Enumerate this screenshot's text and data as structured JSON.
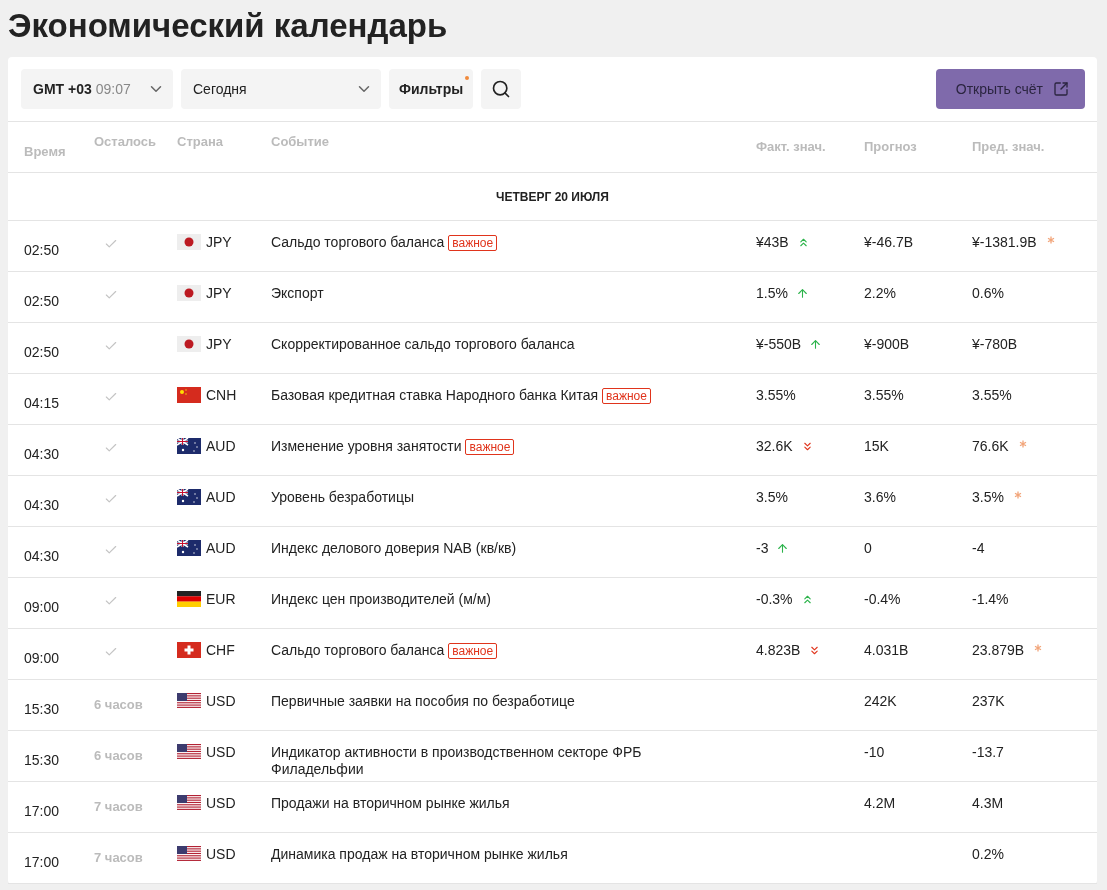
{
  "title": "Экономический календарь",
  "toolbar": {
    "timezone": {
      "label": "GMT +03",
      "time": "09:07"
    },
    "period": "Сегодня",
    "filters": {
      "label": "Фильтры",
      "active": true
    },
    "open_account": "Открыть счёт"
  },
  "table": {
    "columns": [
      "Время",
      "Осталось",
      "Страна",
      "Событие",
      "Факт. знач.",
      "Прогноз",
      "Пред. знач."
    ],
    "day": "ЧЕТВЕРГ 20 ИЮЛЯ",
    "rows": [
      {
        "time": "02:50",
        "done": true,
        "flag": {
          "kind": "jp"
        },
        "currency": "JPY",
        "event": "Сальдо торгового баланса",
        "badge": "важное",
        "actual": "¥43B",
        "trend": {
          "kind": "strongup"
        },
        "forecast": "¥-46.7B",
        "previous": "¥-1381.9B",
        "revised": true
      },
      {
        "time": "02:50",
        "done": true,
        "flag": {
          "kind": "jp"
        },
        "currency": "JPY",
        "event": "Экспорт",
        "actual": "1.5%",
        "trend": {
          "kind": "up"
        },
        "forecast": "2.2%",
        "previous": "0.6%",
        "revised": false
      },
      {
        "time": "02:50",
        "done": true,
        "flag": {
          "kind": "jp"
        },
        "currency": "JPY",
        "event": "Скорректированное сальдо торгового баланса",
        "actual": "¥-550B",
        "trend": {
          "kind": "up"
        },
        "forecast": "¥-900B",
        "previous": "¥-780B",
        "revised": false
      },
      {
        "time": "04:15",
        "done": true,
        "flag": {
          "kind": "cn"
        },
        "currency": "CNH",
        "event": "Базовая кредитная ставка Народного банка Китая",
        "badge": "важное",
        "actual": "3.55%",
        "forecast": "3.55%",
        "previous": "3.55%",
        "revised": false
      },
      {
        "time": "04:30",
        "done": true,
        "flag": {
          "kind": "au"
        },
        "currency": "AUD",
        "event": "Изменение уровня занятости",
        "badge": "важное",
        "actual": "32.6K",
        "trend": {
          "kind": "strongdown"
        },
        "forecast": "15K",
        "previous": "76.6K",
        "revised": true
      },
      {
        "time": "04:30",
        "done": true,
        "flag": {
          "kind": "au"
        },
        "currency": "AUD",
        "event": "Уровень безработицы",
        "actual": "3.5%",
        "forecast": "3.6%",
        "previous": "3.5%",
        "revised": true
      },
      {
        "time": "04:30",
        "done": true,
        "flag": {
          "kind": "au"
        },
        "currency": "AUD",
        "event": "Индекс делового доверия NAB (кв/кв)",
        "actual": "-3",
        "trend": {
          "kind": "up"
        },
        "forecast": "0",
        "previous": "-4",
        "revised": false
      },
      {
        "time": "09:00",
        "done": true,
        "flag": {
          "kind": "de"
        },
        "currency": "EUR",
        "event": "Индекс цен производителей (м/м)",
        "actual": "-0.3%",
        "trend": {
          "kind": "strongup"
        },
        "forecast": "-0.4%",
        "previous": "-1.4%",
        "revised": false
      },
      {
        "time": "09:00",
        "done": true,
        "flag": {
          "kind": "ch"
        },
        "currency": "CHF",
        "event": "Сальдо торгового баланса",
        "badge": "важное",
        "actual": "4.823B",
        "trend": {
          "kind": "strongdown"
        },
        "forecast": "4.031B",
        "previous": "23.879B",
        "revised": true
      },
      {
        "time": "15:30",
        "done": false,
        "remaining": "6 часов",
        "flag": {
          "kind": "us"
        },
        "currency": "USD",
        "event": "Первичные заявки на пособия по безработице",
        "forecast": "242K",
        "previous": "237K",
        "revised": false
      },
      {
        "time": "15:30",
        "done": false,
        "remaining": "6 часов",
        "flag": {
          "kind": "us"
        },
        "currency": "USD",
        "event": "Индикатор активности в производственном секторе ФРБ Филадельфии",
        "forecast": "-10",
        "previous": "-13.7",
        "revised": false
      },
      {
        "time": "17:00",
        "done": false,
        "remaining": "7 часов",
        "flag": {
          "kind": "us"
        },
        "currency": "USD",
        "event": "Продажи на вторичном рынке жилья",
        "forecast": "4.2M",
        "previous": "4.3M",
        "revised": false
      },
      {
        "time": "17:00",
        "done": false,
        "remaining": "7 часов",
        "flag": {
          "kind": "us"
        },
        "currency": "USD",
        "event": "Динамика продаж на вторичном рынке жилья",
        "previous": "0.2%",
        "revised": false
      }
    ]
  }
}
